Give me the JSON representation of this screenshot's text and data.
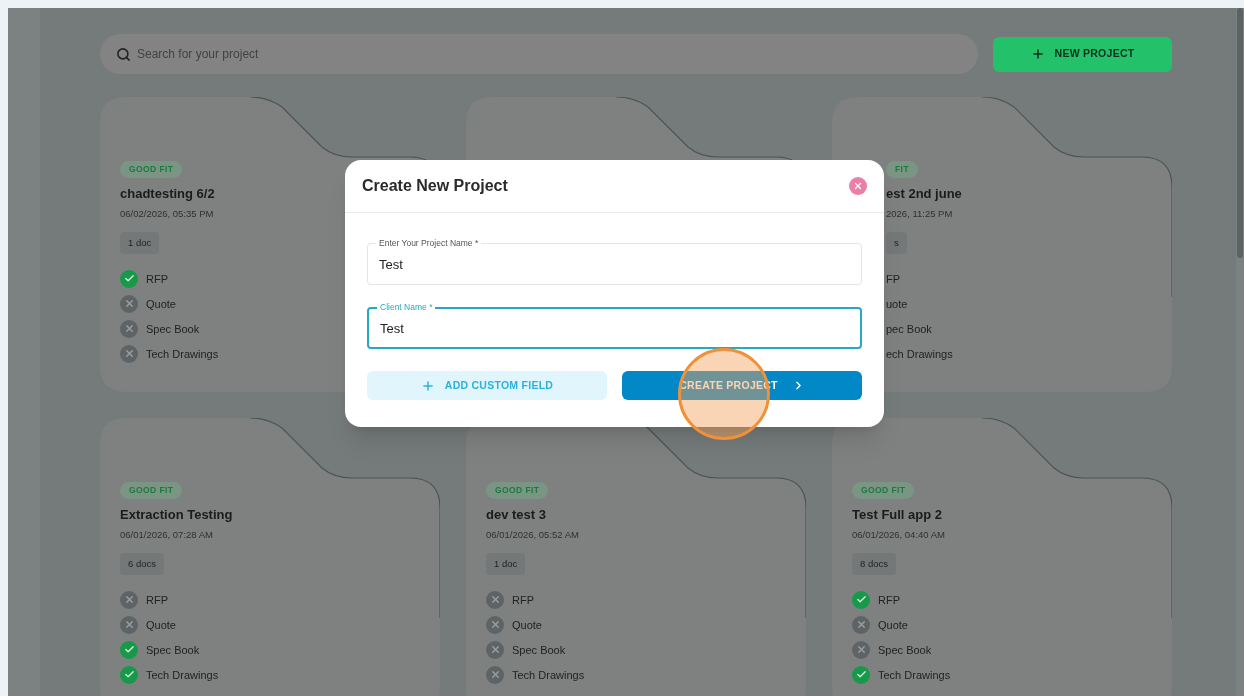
{
  "search": {
    "placeholder": "Search for your project"
  },
  "new_project_button": {
    "label": "NEW PROJECT"
  },
  "projects": [
    {
      "kind": "card",
      "badge": "GOOD FIT",
      "title": "chadtesting 6/2",
      "date": "06/02/2026, 05:35 PM",
      "docs": "1 doc",
      "items": [
        {
          "label": "RFP",
          "checked": true
        },
        {
          "label": "Quote",
          "checked": false
        },
        {
          "label": "Spec Book",
          "checked": false
        },
        {
          "label": "Tech Drawings",
          "checked": false
        }
      ]
    },
    {
      "kind": "hidden"
    },
    {
      "kind": "clipped",
      "badge": "FIT",
      "title": "est 2nd june",
      "date": "2026, 11:25 PM",
      "docs": "s",
      "items": [
        {
          "label": "FP"
        },
        {
          "label": "uote"
        },
        {
          "label": "pec Book"
        },
        {
          "label": "ech Drawings"
        }
      ]
    },
    {
      "kind": "card",
      "badge": "GOOD FIT",
      "title": "Extraction Testing",
      "date": "06/01/2026, 07:28 AM",
      "docs": "6 docs",
      "items": [
        {
          "label": "RFP",
          "checked": false
        },
        {
          "label": "Quote",
          "checked": false
        },
        {
          "label": "Spec Book",
          "checked": true
        },
        {
          "label": "Tech Drawings",
          "checked": true
        }
      ]
    },
    {
      "kind": "card",
      "badge": "GOOD FIT",
      "title": "dev test 3",
      "date": "06/01/2026, 05:52 AM",
      "docs": "1 doc",
      "items": [
        {
          "label": "RFP",
          "checked": false
        },
        {
          "label": "Quote",
          "checked": false
        },
        {
          "label": "Spec Book",
          "checked": false
        },
        {
          "label": "Tech Drawings",
          "checked": false
        }
      ]
    },
    {
      "kind": "card",
      "badge": "GOOD FIT",
      "title": "Test Full app 2",
      "date": "06/01/2026, 04:40 AM",
      "docs": "8 docs",
      "items": [
        {
          "label": "RFP",
          "checked": true
        },
        {
          "label": "Quote",
          "checked": false
        },
        {
          "label": "Spec Book",
          "checked": false
        },
        {
          "label": "Tech Drawings",
          "checked": true
        }
      ]
    }
  ],
  "dialog": {
    "title": "Create New Project",
    "fields": [
      {
        "label": "Enter Your Project Name *",
        "value": "Test",
        "focused": false
      },
      {
        "label": "Client Name *",
        "value": "Test",
        "focused": true
      }
    ],
    "buttons": [
      {
        "kind": "secondary",
        "label": "ADD CUSTOM FIELD"
      },
      {
        "kind": "primary",
        "label": "CREATE PROJECT"
      }
    ]
  }
}
